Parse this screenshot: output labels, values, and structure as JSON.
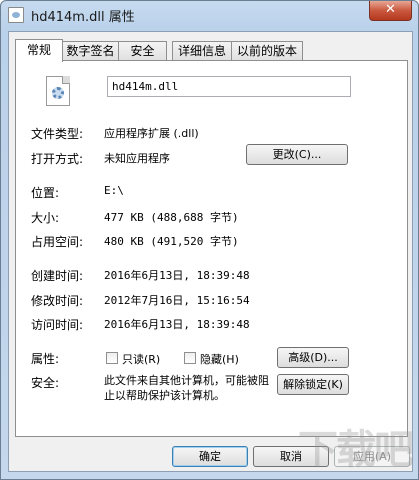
{
  "window": {
    "title": "hd414m.dll 属性",
    "close_label": "✕"
  },
  "tabs": [
    {
      "label": "常规",
      "active": true
    },
    {
      "label": "数字签名",
      "active": false
    },
    {
      "label": "安全",
      "active": false
    },
    {
      "label": "详细信息",
      "active": false
    },
    {
      "label": "以前的版本",
      "active": false
    }
  ],
  "general": {
    "file_name": "hd414m.dll",
    "file_type_label": "文件类型:",
    "file_type_value": "应用程序扩展 (.dll)",
    "open_with_label": "打开方式:",
    "open_with_value": "未知应用程序",
    "change_button": "更改(C)...",
    "location_label": "位置:",
    "location_value": "E:\\",
    "size_label": "大小:",
    "size_value": "477 KB (488,688 字节)",
    "size_on_disk_label": "占用空间:",
    "size_on_disk_value": "480 KB (491,520 字节)",
    "created_label": "创建时间:",
    "created_value": "2016年6月13日, 18:39:48",
    "modified_label": "修改时间:",
    "modified_value": "2012年7月16日, 15:16:54",
    "accessed_label": "访问时间:",
    "accessed_value": "2016年6月13日, 18:39:48",
    "attributes_label": "属性:",
    "readonly_label": "只读(R)",
    "hidden_label": "隐藏(H)",
    "advanced_button": "高级(D)...",
    "security_label": "安全:",
    "security_text": "此文件来自其他计算机，可能被阻止以帮助保护该计算机。",
    "unblock_button": "解除锁定(K)"
  },
  "footer": {
    "ok_button": "确定",
    "cancel_button": "取消",
    "apply_button": "应用(A)"
  },
  "watermark": "下载吧"
}
